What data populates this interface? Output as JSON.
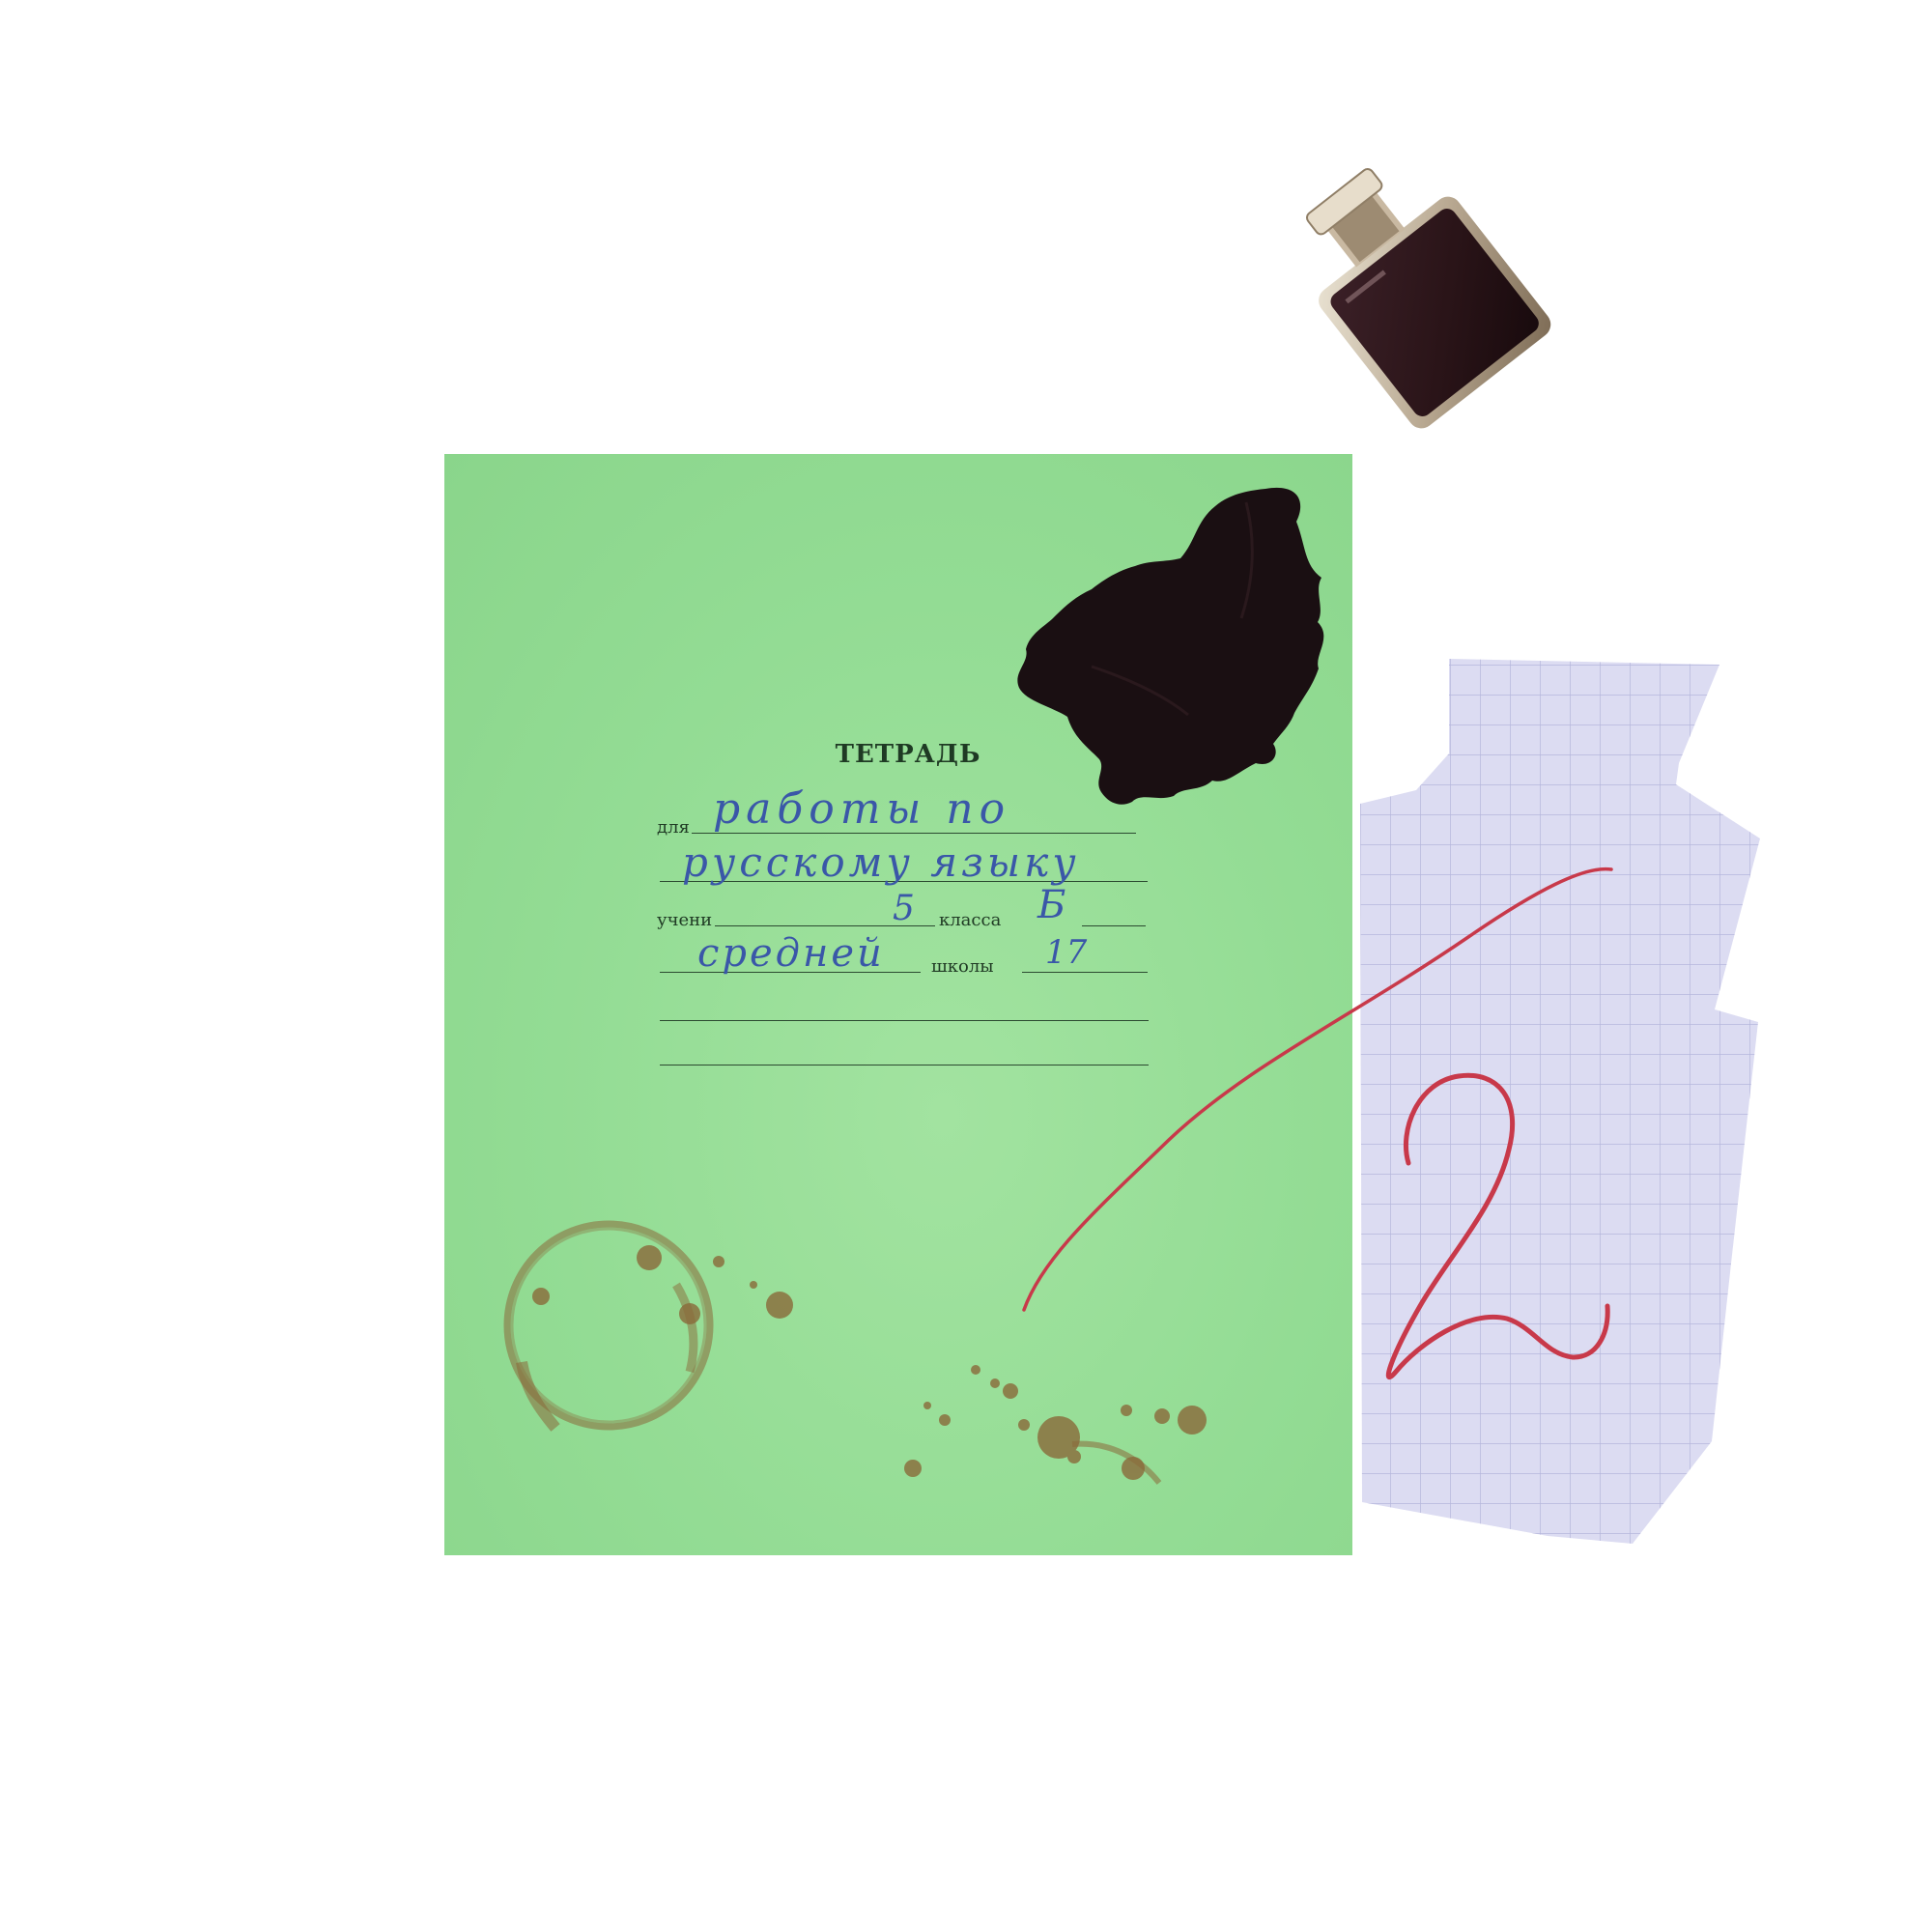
{
  "notebook": {
    "title": "ТЕТРАДЬ",
    "labels": {
      "for": "для",
      "student": "учени",
      "class": "класса",
      "school": "школы"
    },
    "handwriting": {
      "subject_line1": "работы по",
      "subject_line2": "русскому языку",
      "grade_number": "5",
      "class_letter": "Б",
      "school_type": "средней",
      "school_number": "17"
    }
  },
  "grade_sheet": {
    "mark": "2"
  },
  "colors": {
    "cover": "#93dc94",
    "ink_blue": "#3a57a8",
    "ink_black": "#1a0f12",
    "red_pen": "#c8394a",
    "graph_paper": "#dcdcf2",
    "coffee_stain": "#8a6a3a"
  }
}
